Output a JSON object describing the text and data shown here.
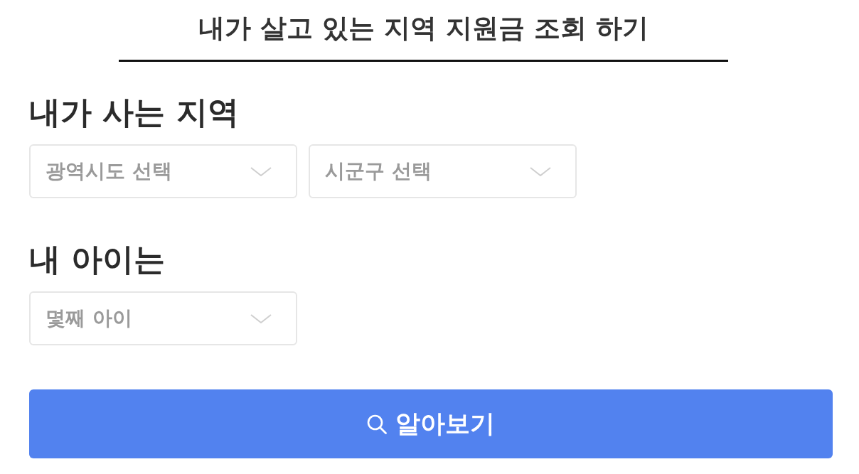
{
  "title": "내가 살고 있는 지역 지원금 조회 하기",
  "sections": [
    {
      "heading": "내가 사는 지역",
      "selects": [
        {
          "placeholder": "광역시도 선택"
        },
        {
          "placeholder": "시군구 선택"
        }
      ]
    },
    {
      "heading": "내 아이는",
      "selects": [
        {
          "placeholder": "몇째 아이"
        }
      ]
    }
  ],
  "submit_button": {
    "label": "알아보기"
  }
}
